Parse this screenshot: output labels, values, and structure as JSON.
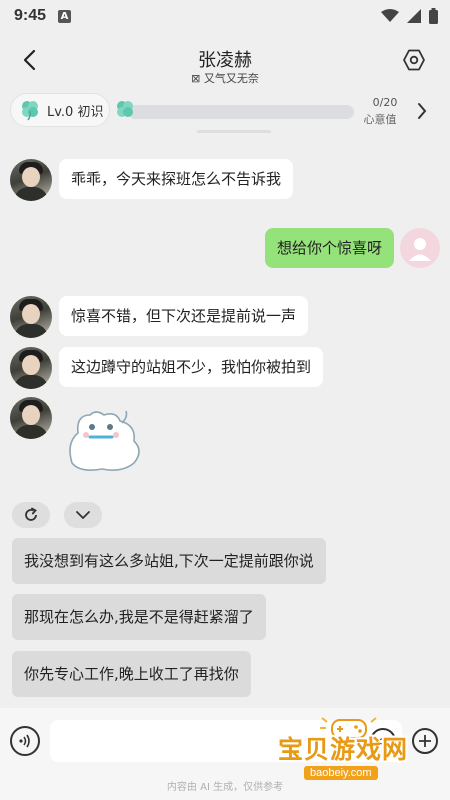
{
  "status_bar": {
    "time": "9:45",
    "notification_letter": "A"
  },
  "header": {
    "title": "张凌赫",
    "subtitle": "⊠ 又气又无奈"
  },
  "level": {
    "label": "Lv.0 初识",
    "progress_text": "0/20",
    "progress_fraction": 0.0,
    "progress_label": "心意值"
  },
  "messages": [
    {
      "from": "character",
      "text": "乖乖，今天来探班怎么不告诉我"
    },
    {
      "from": "user",
      "text": "想给你个惊喜呀"
    },
    {
      "from": "character",
      "text": "惊喜不错，但下次还是提前说一声"
    },
    {
      "from": "character",
      "text": "这边蹲守的站姐不少，我怕你被拍到"
    },
    {
      "from": "character",
      "type": "sticker"
    }
  ],
  "suggestions": [
    "我没想到有这么多站姐,下次一定提前跟你说",
    "那现在怎么办,我是不是得赶紧溜了",
    "你先专心工作,晚上收工了再找你"
  ],
  "input": {
    "placeholder": "",
    "ai_note": "内容由 AI 生成，仅供参考"
  },
  "watermark": {
    "name": "宝贝游戏网",
    "url": "baobeiy.com"
  },
  "colors": {
    "user_bubble": "#95e27a",
    "accent_teal": "#4fbfa6",
    "watermark": "#e89a15"
  }
}
